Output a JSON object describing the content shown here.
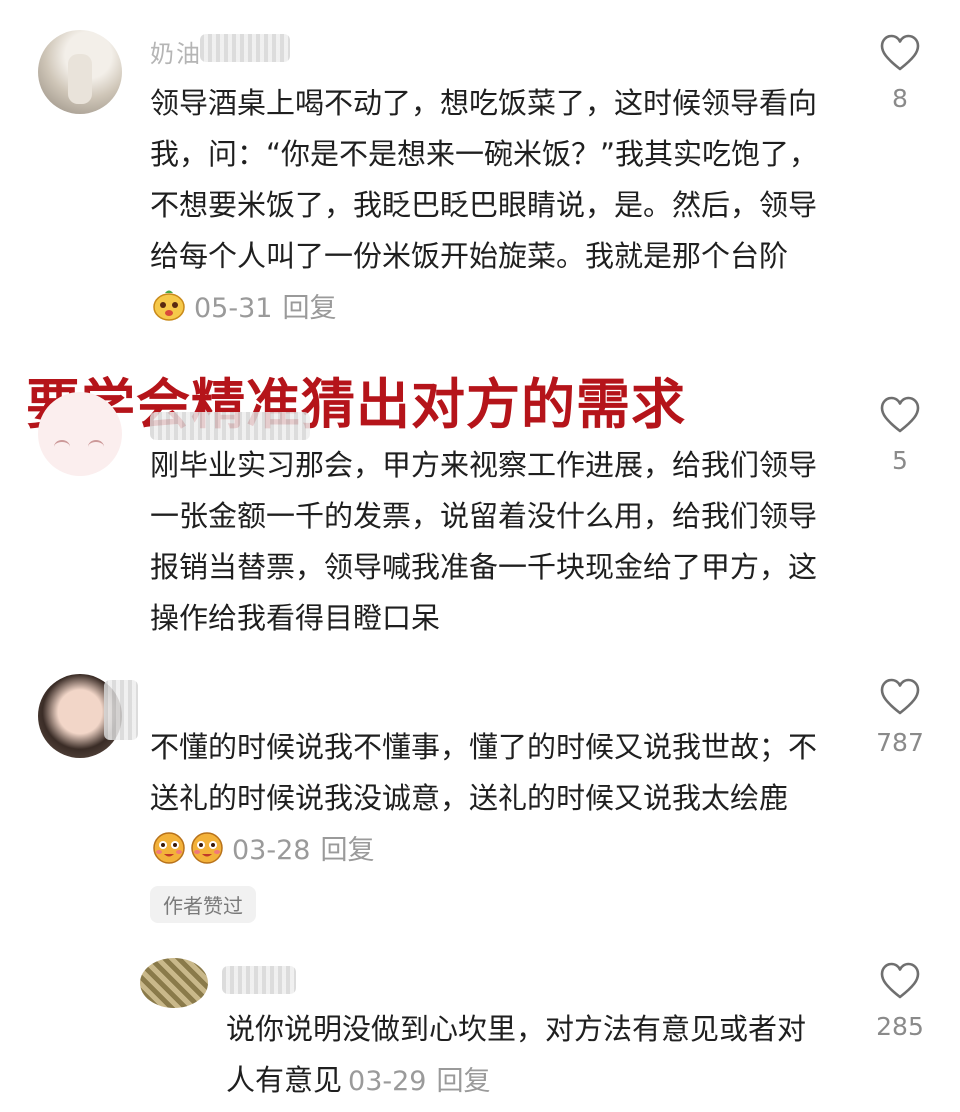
{
  "comments": [
    {
      "name": "奶油",
      "text": "领导酒桌上喝不动了，想吃饭菜了，这时候领导看向我，问：“你是不是想来一碗米饭？”我其实吃饱了，不想要米饭了，我眨巴眨巴眼睛说，是。然后，领导给每个人叫了一份米饭开始旋菜。我就是那个台阶",
      "emoji": "smile-face-emoji",
      "date": "05-31",
      "reply": "回复",
      "likes": "8"
    },
    {
      "text": "刚毕业实习那会，甲方来视察工作进展，给我们领导一张金额一千的发票，说留着没什么用，给我们领导报销当替票，领导喊我准备一千块现金给了甲方，这操作给我看得目瞪口呆",
      "likes": "5"
    },
    {
      "text": "不懂的时候说我不懂事，懂了的时候又说我世故；不送礼的时候说我没诚意，送礼的时候又说我太绘鹿",
      "emoji": "blushing-face-emoji",
      "date": "03-28",
      "reply": "回复",
      "likes": "787",
      "badge": "作者赞过"
    },
    {
      "text": "说你说明没做到心坎里，对方法有意见或者对人有意见",
      "date": "03-29",
      "reply": "回复",
      "likes": "285"
    }
  ],
  "overlay_title": "要学会精准猜出对方的需求",
  "colors": {
    "overlay_red": "#b5141a",
    "meta_gray": "#9a9a9a",
    "text_dark": "#1f1f1f"
  },
  "icons": [
    "heart-outline-icon",
    "avatar",
    "smile-face-emoji",
    "blushing-face-emoji"
  ]
}
